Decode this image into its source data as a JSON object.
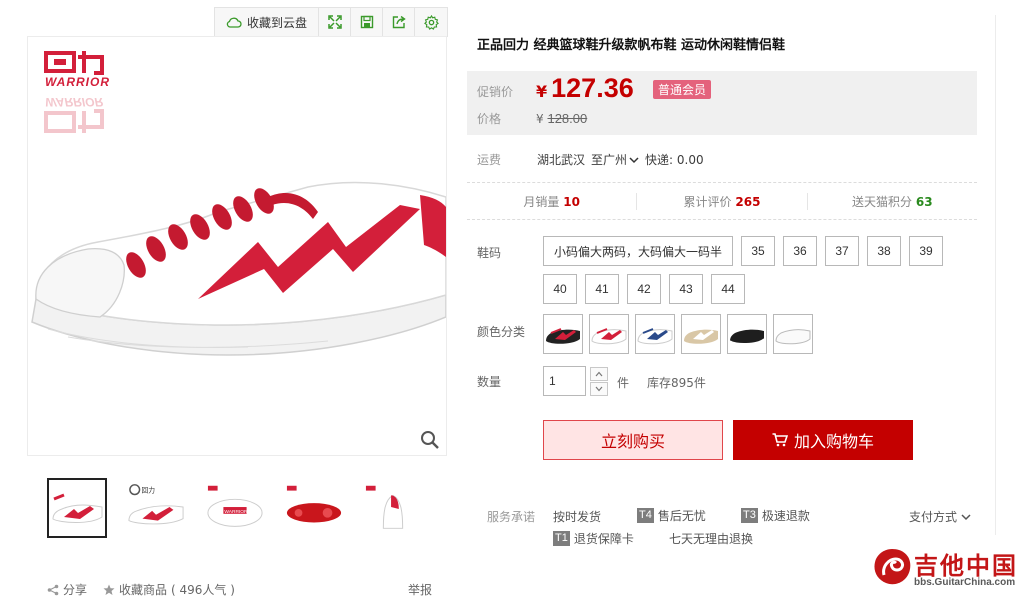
{
  "toolbar": {
    "cloud_label": "收藏到云盘",
    "icons": [
      "cloud-icon",
      "fullscreen-icon",
      "save-icon",
      "share-out-icon",
      "settings-icon"
    ]
  },
  "gallery": {
    "brand": "WARRIOR",
    "brand_cn": "回力",
    "thumbnails": [
      "front-view",
      "side-view",
      "top-view",
      "sole-view",
      "back-view"
    ],
    "active_thumbnail": 0
  },
  "footer": {
    "share_label": "分享",
    "favorite_label": "收藏商品",
    "favorite_count": "( 496人气 )",
    "report_label": "举报"
  },
  "product": {
    "title": "正品回力 经典篮球鞋升级款帆布鞋 运动休闲鞋情侣鞋"
  },
  "price": {
    "promo_label": "促销价",
    "currency": "¥",
    "promo_value": "127.36",
    "member_badge": "普通会员",
    "orig_label": "价格",
    "orig_value": "128.00"
  },
  "shipping": {
    "label": "运费",
    "from": "湖北武汉",
    "to": "至广州",
    "express": "快递: 0.00"
  },
  "stats": {
    "monthly_label": "月销量",
    "monthly_value": "10",
    "reviews_label": "累计评价",
    "reviews_value": "265",
    "points_label": "送天猫积分",
    "points_value": "63"
  },
  "size": {
    "label": "鞋码",
    "note": "小码偏大两码，大码偏大一码半",
    "options": [
      "35",
      "36",
      "37",
      "38",
      "39",
      "40",
      "41",
      "42",
      "43",
      "44"
    ]
  },
  "color": {
    "label": "颜色分类",
    "options": [
      "black-red",
      "white-red",
      "white-blue",
      "beige",
      "black",
      "white"
    ]
  },
  "quantity": {
    "label": "数量",
    "value": "1",
    "unit": "件",
    "stock": "库存895件"
  },
  "actions": {
    "buy_now": "立刻购买",
    "add_to_cart": "加入购物车"
  },
  "service": {
    "label": "服务承诺",
    "on_time": "按时发货",
    "t4_tag": "T4",
    "t4_text": "售后无忧",
    "t3_tag": "T3",
    "t3_text": "极速退款",
    "t1_tag": "T1",
    "t1_text": "退货保障卡",
    "seven_day": "七天无理由退换",
    "payment": "支付方式"
  },
  "watermark": {
    "text": "吉他中国",
    "url": "bbs.GuitarChina.com"
  },
  "colors": {
    "accent_red": "#c40000",
    "badge_pink": "#e4627c",
    "shoe_red": "#d31f3a",
    "toolbar_green": "#3a9a2a"
  }
}
